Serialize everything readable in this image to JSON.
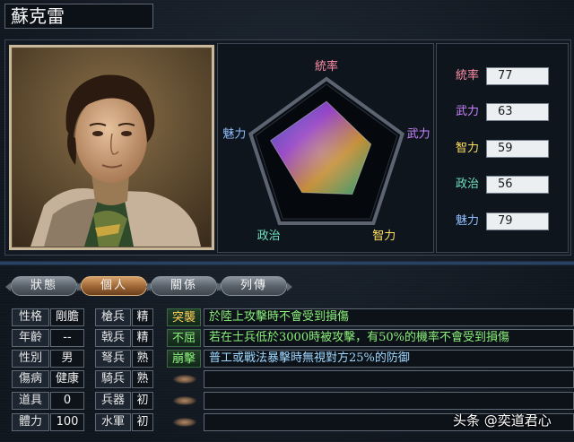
{
  "officer": {
    "name": "蘇克雷"
  },
  "radar": {
    "labels": [
      "統率",
      "武力",
      "智力",
      "政治",
      "魅力"
    ],
    "label_colors": [
      "#ff8fa8",
      "#c985ff",
      "#ffe060",
      "#6fe0c0",
      "#8fc0ff"
    ],
    "values": [
      77,
      63,
      59,
      56,
      79
    ],
    "max": 100
  },
  "stats": [
    {
      "label": "統率",
      "value": "77",
      "color": "#ff8fa8"
    },
    {
      "label": "武力",
      "value": "63",
      "color": "#c985ff"
    },
    {
      "label": "智力",
      "value": "59",
      "color": "#ffe060"
    },
    {
      "label": "政治",
      "value": "56",
      "color": "#6fe0c0"
    },
    {
      "label": "魅力",
      "value": "79",
      "color": "#8fc0ff"
    }
  ],
  "tabs": [
    {
      "label": "狀態",
      "active": false
    },
    {
      "label": "個人",
      "active": true
    },
    {
      "label": "關係",
      "active": false
    },
    {
      "label": "列傳",
      "active": false
    }
  ],
  "personal": [
    {
      "label": "性格",
      "value": "剛膽"
    },
    {
      "label": "年齡",
      "value": "--"
    },
    {
      "label": "性別",
      "value": "男"
    },
    {
      "label": "傷病",
      "value": "健康"
    },
    {
      "label": "道具",
      "value": "0"
    },
    {
      "label": "體力",
      "value": "100"
    }
  ],
  "aptitudes": [
    {
      "label": "槍兵",
      "grade": "精"
    },
    {
      "label": "戟兵",
      "grade": "精"
    },
    {
      "label": "弩兵",
      "grade": "熟"
    },
    {
      "label": "騎兵",
      "grade": "熟"
    },
    {
      "label": "兵器",
      "grade": "初"
    },
    {
      "label": "水軍",
      "grade": "初"
    }
  ],
  "skills": [
    {
      "name": "突襲",
      "name_color": "#ffd25a",
      "desc": "於陸上攻擊時不會受到損傷",
      "desc_color": "#8af07a"
    },
    {
      "name": "不屈",
      "name_color": "#8af07a",
      "desc": "若在士兵低於3000時被攻擊，有50%的機率不會受到損傷",
      "desc_color": "#8af07a"
    },
    {
      "name": "崩擊",
      "name_color": "#8af07a",
      "desc": "普工或戰法暴擊時無視對方25%的防御",
      "desc_color": "#9fd8ff"
    },
    {
      "name": "",
      "desc": ""
    },
    {
      "name": "",
      "desc": ""
    },
    {
      "name": "",
      "desc": ""
    }
  ],
  "watermark": {
    "text": "头条 @奕道君心"
  }
}
